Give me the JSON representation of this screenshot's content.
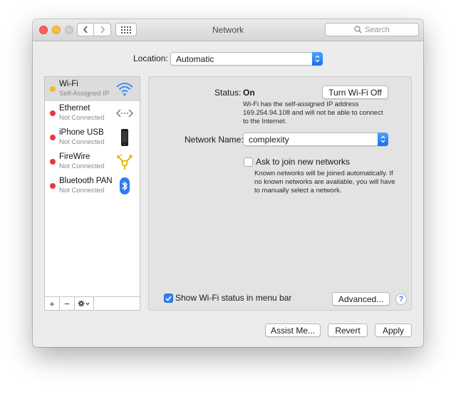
{
  "window": {
    "title": "Network",
    "search_placeholder": "Search"
  },
  "location": {
    "label": "Location:",
    "value": "Automatic"
  },
  "services": [
    {
      "name": "Wi-Fi",
      "status": "Self-Assigned IP",
      "dot_color": "#f4b92b",
      "icon": "wifi-icon"
    },
    {
      "name": "Ethernet",
      "status": "Not Connected",
      "dot_color": "#e8393c",
      "icon": "ethernet-icon"
    },
    {
      "name": "iPhone USB",
      "status": "Not Connected",
      "dot_color": "#e8393c",
      "icon": "iphone-icon"
    },
    {
      "name": "FireWire",
      "status": "Not Connected",
      "dot_color": "#e8393c",
      "icon": "firewire-icon"
    },
    {
      "name": "Bluetooth PAN",
      "status": "Not Connected",
      "dot_color": "#e8393c",
      "icon": "bluetooth-icon"
    }
  ],
  "sidebar_tools": {
    "add": "+",
    "remove": "−"
  },
  "detail": {
    "status_label": "Status:",
    "status_value": "On",
    "turn_off_button": "Turn Wi-Fi Off",
    "status_desc_line1": "Wi-Fi has the self-assigned IP address",
    "status_desc_line2": "169.254.94.108 and will not be able to connect",
    "status_desc_line3": "to the Internet.",
    "network_name_label": "Network Name:",
    "network_name_value": "complexity",
    "ask_to_join_label": "Ask to join new networks",
    "ask_to_join_checked": false,
    "ask_desc_line1": "Known networks will be joined automatically. If",
    "ask_desc_line2": "no known networks are available, you will have",
    "ask_desc_line3": "to manually select a network.",
    "show_status_label": "Show Wi-Fi status in menu bar",
    "show_status_checked": true,
    "advanced_button": "Advanced...",
    "help": "?"
  },
  "footer": {
    "assist_button": "Assist Me...",
    "revert_button": "Revert",
    "apply_button": "Apply"
  },
  "colors": {
    "accent": "#2f80ed",
    "wifi_blue": "#3d8ef0"
  }
}
